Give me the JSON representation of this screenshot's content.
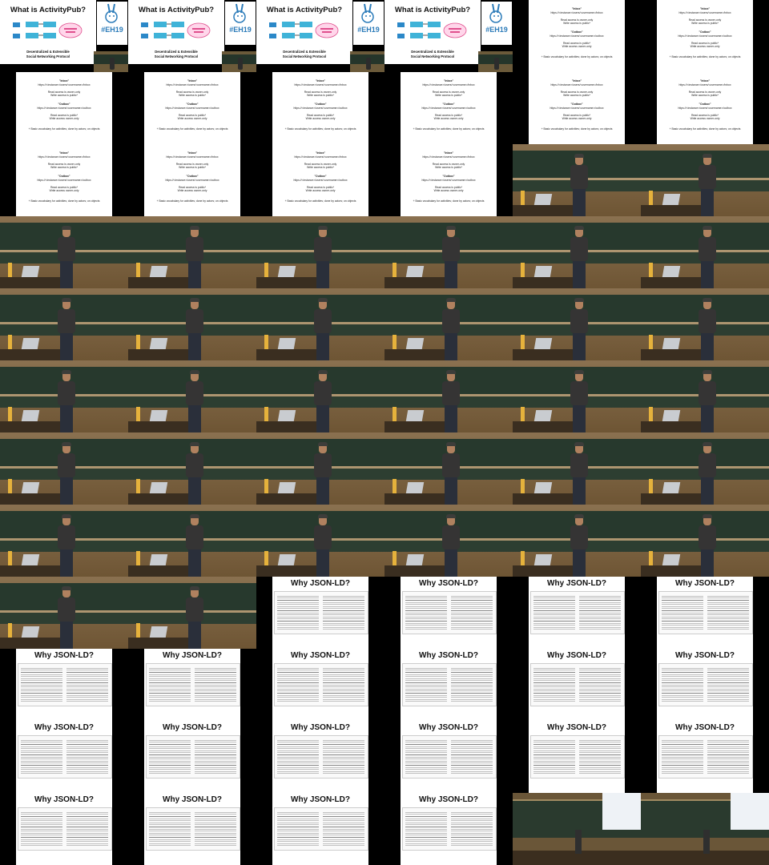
{
  "slides": {
    "activitypub": {
      "title": "What is ActivityPub?",
      "subtitle_line1": "Decentralized & Extensible",
      "subtitle_line2": "Social Networking Protocol",
      "tag": "#EH19"
    },
    "inbox_outbox": {
      "inbox_heading": "\"Inbox\"",
      "inbox_url": "https://<instance>/users/<username>/inbox",
      "inbox_read": "Read access is owner-only",
      "inbox_write": "Write access is public*",
      "outbox_heading": "\"Outbox\"",
      "outbox_url": "https://<instance>/users/<username>/outbox",
      "outbox_read": "Read access is public*",
      "outbox_write": "Write access owner-only",
      "vocab": "+ Basic vocabulary for activities; done by actors; on objects"
    },
    "jsonld": {
      "title": "Why JSON-LD?"
    }
  },
  "tiles": [
    "activitypub",
    "activitypub",
    "activitypub",
    "activitypub",
    "inbox_outbox",
    "inbox_outbox",
    "inbox_outbox",
    "inbox_outbox",
    "inbox_outbox",
    "inbox_outbox",
    "inbox_outbox",
    "inbox_outbox",
    "inbox_outbox",
    "inbox_outbox",
    "inbox_outbox",
    "inbox_outbox",
    "photo",
    "photo",
    "photo",
    "photo",
    "photo",
    "photo",
    "photo",
    "photo",
    "photo",
    "photo",
    "photo",
    "photo",
    "photo",
    "photo",
    "photo",
    "photo",
    "photo",
    "photo",
    "photo",
    "photo",
    "photo",
    "photo",
    "photo",
    "photo",
    "photo",
    "photo",
    "photo",
    "photo",
    "photo",
    "photo",
    "photo",
    "photo",
    "photo",
    "photo",
    "jsonld",
    "jsonld",
    "jsonld",
    "jsonld",
    "jsonld",
    "jsonld",
    "jsonld",
    "jsonld",
    "jsonld",
    "jsonld",
    "jsonld",
    "jsonld",
    "jsonld",
    "jsonld",
    "jsonld",
    "jsonld",
    "jsonld",
    "jsonld",
    "jsonld",
    "jsonld",
    "wide",
    "wide"
  ],
  "colors": {
    "background": "#000000",
    "slide_bg": "#ffffff",
    "chalkboard": "#27392d",
    "wall": "#7a6240",
    "eh_blue": "#2b7bb9"
  }
}
